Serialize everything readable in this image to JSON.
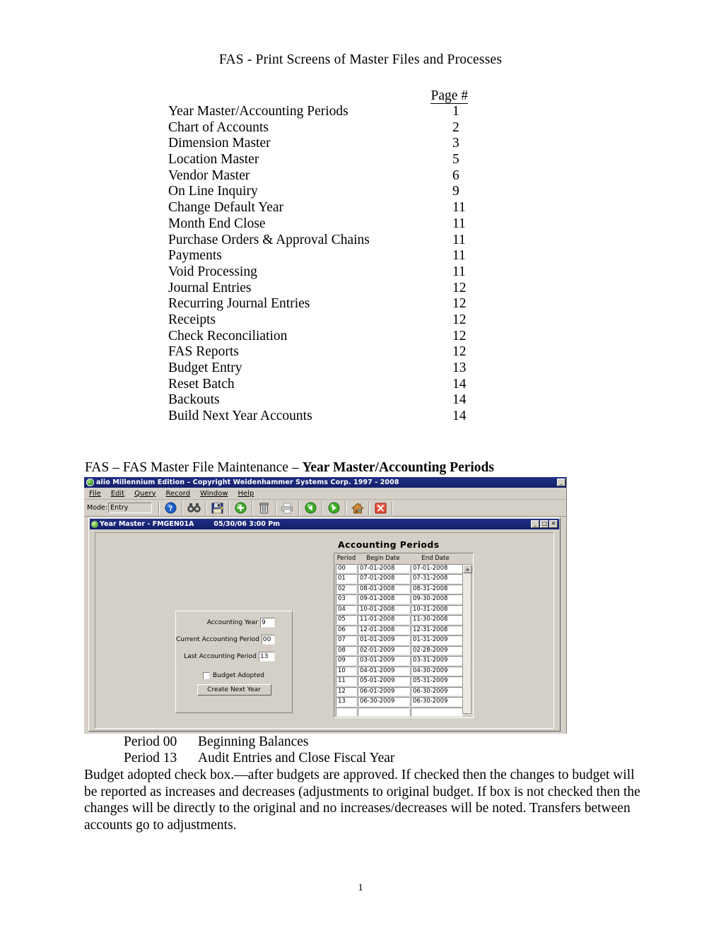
{
  "document": {
    "title": "FAS - Print Screens of Master Files and Processes",
    "page_number": "1",
    "toc_header": "Page #",
    "toc": [
      {
        "label": "Year Master/Accounting Periods",
        "page": "1"
      },
      {
        "label": "Chart of Accounts",
        "page": "2"
      },
      {
        "label": "Dimension Master",
        "page": "3"
      },
      {
        "label": "Location Master",
        "page": "5"
      },
      {
        "label": "Vendor Master",
        "page": "6"
      },
      {
        "label": "On Line Inquiry",
        "page": "9"
      },
      {
        "label": "Change Default Year",
        "page": "11"
      },
      {
        "label": "Month End Close",
        "page": "11"
      },
      {
        "label": "Purchase Orders & Approval Chains",
        "page": "11"
      },
      {
        "label": "Payments",
        "page": "11"
      },
      {
        "label": "Void Processing",
        "page": "11"
      },
      {
        "label": "Journal Entries",
        "page": "12"
      },
      {
        "label": "Recurring Journal Entries",
        "page": "12"
      },
      {
        "label": "Receipts",
        "page": "12"
      },
      {
        "label": "Check Reconciliation",
        "page": "12"
      },
      {
        "label": "FAS Reports",
        "page": "12"
      },
      {
        "label": "Budget Entry",
        "page": "13"
      },
      {
        "label": "Reset Batch",
        "page": "14"
      },
      {
        "label": "Backouts",
        "page": "14"
      },
      {
        "label": "Build Next Year Accounts",
        "page": "14"
      }
    ],
    "section_heading_normal": "FAS – FAS Master File Maintenance – ",
    "section_heading_bold": "Year Master/Accounting Periods",
    "period_notes": [
      {
        "key": "Period 00",
        "value": "Beginning Balances"
      },
      {
        "key": "Period 13",
        "value": "Audit Entries and Close Fiscal Year"
      }
    ],
    "paragraph": "Budget adopted check box.—after budgets are approved.  If checked then the changes to budget will be reported as increases and decreases (adjustments to original budget.  If box is not checked then the changes will be directly to the original and no increases/decreases will be noted.  Transfers between accounts go to adjustments."
  },
  "app": {
    "title": "alio Millennium Edition – Copyright Weidenhammer Systems Corp. 1997 - 2008",
    "minimize_label": "_",
    "menu": [
      {
        "label": "File"
      },
      {
        "label": "Edit"
      },
      {
        "label": "Query"
      },
      {
        "label": "Record"
      },
      {
        "label": "Window"
      },
      {
        "label": "Help"
      }
    ],
    "toolbar": {
      "mode_label": "Mode:",
      "mode_value": "Entry",
      "buttons": [
        {
          "name": "help-icon",
          "label": "Help"
        },
        {
          "name": "find-icon",
          "label": "Find"
        },
        {
          "name": "save-icon",
          "label": "Save"
        },
        {
          "name": "add-icon",
          "label": "Add"
        },
        {
          "name": "delete-icon",
          "label": "Delete"
        },
        {
          "name": "print-icon",
          "label": "Print"
        },
        {
          "name": "previous-icon",
          "label": "Previous"
        },
        {
          "name": "next-icon",
          "label": "Next"
        },
        {
          "name": "home-icon",
          "label": "Home"
        },
        {
          "name": "close-icon",
          "label": "Close"
        }
      ]
    },
    "child_window": {
      "title": "Year Master - FMGEN01A",
      "timestamp": "05/30/06   3:00 Pm",
      "minimize_label": "_",
      "maximize_label": "□",
      "close_label": "✕"
    },
    "form": {
      "panel_title": "Accounting Periods",
      "accounting_year_label": "Accounting Year",
      "accounting_year_value": "9",
      "current_period_label": "Current Accounting Period",
      "current_period_value": "00",
      "last_period_label": "Last Accounting Period",
      "last_period_value": "13",
      "budget_adopted_label": "Budget Adopted",
      "budget_adopted_checked": false,
      "create_next_year_label": "Create Next Year"
    },
    "grid": {
      "columns": [
        "Period",
        "Begin Date",
        "End Date"
      ],
      "rows": [
        {
          "period": "00",
          "begin": "07-01-2008",
          "end": "07-01-2008"
        },
        {
          "period": "01",
          "begin": "07-01-2008",
          "end": "07-31-2008"
        },
        {
          "period": "02",
          "begin": "08-01-2008",
          "end": "08-31-2008"
        },
        {
          "period": "03",
          "begin": "09-01-2008",
          "end": "09-30-2008"
        },
        {
          "period": "04",
          "begin": "10-01-2008",
          "end": "10-31-2008"
        },
        {
          "period": "05",
          "begin": "11-01-2008",
          "end": "11-30-2008"
        },
        {
          "period": "06",
          "begin": "12-01-2008",
          "end": "12-31-2008"
        },
        {
          "period": "07",
          "begin": "01-01-2009",
          "end": "01-31-2009"
        },
        {
          "period": "08",
          "begin": "02-01-2009",
          "end": "02-28-2009"
        },
        {
          "period": "09",
          "begin": "03-01-2009",
          "end": "03-31-2009"
        },
        {
          "period": "10",
          "begin": "04-01-2009",
          "end": "04-30-2009"
        },
        {
          "period": "11",
          "begin": "05-01-2009",
          "end": "05-31-2009"
        },
        {
          "period": "12",
          "begin": "06-01-2009",
          "end": "06-30-2009"
        },
        {
          "period": "13",
          "begin": "06-30-2009",
          "end": "06-30-2009"
        },
        {
          "period": "",
          "begin": "",
          "end": ""
        }
      ]
    },
    "colors": {
      "titlebar": "#1f2f85",
      "window_face": "#d4d0c8",
      "field_background": "#ffffff"
    }
  }
}
